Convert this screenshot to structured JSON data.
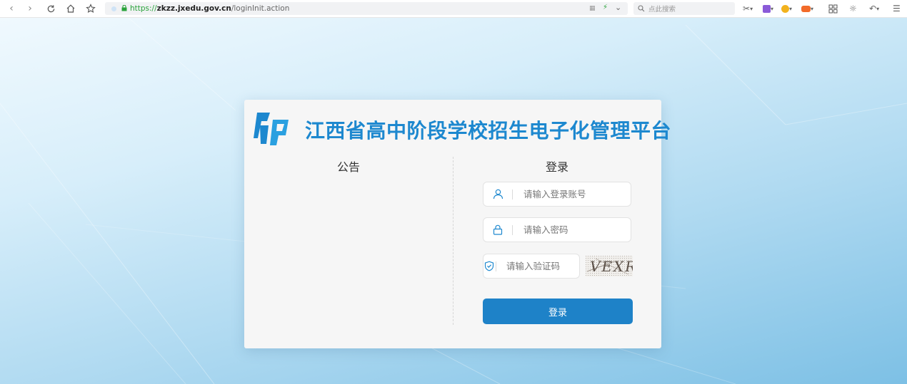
{
  "browser": {
    "url_scheme": "https://",
    "url_host": "zkzz.jxedu.gov.cn",
    "url_path": "/loginInit.action",
    "search_placeholder": "点此搜索",
    "lock_color": "#2aa33b"
  },
  "card": {
    "title": "江西省高中阶段学校招生电子化管理平台",
    "notice_heading": "公告",
    "login_heading": "登录",
    "accent_color": "#1d88cf"
  },
  "login_form": {
    "account_placeholder": "请输入登录账号",
    "password_placeholder": "请输入密码",
    "captcha_placeholder": "请输入验证码",
    "captcha_text": "VEXR",
    "submit_label": "登录",
    "button_color": "#1e82c8"
  },
  "icons": {
    "account": "user-icon",
    "password": "lock-icon",
    "captcha": "shield-check-icon"
  }
}
